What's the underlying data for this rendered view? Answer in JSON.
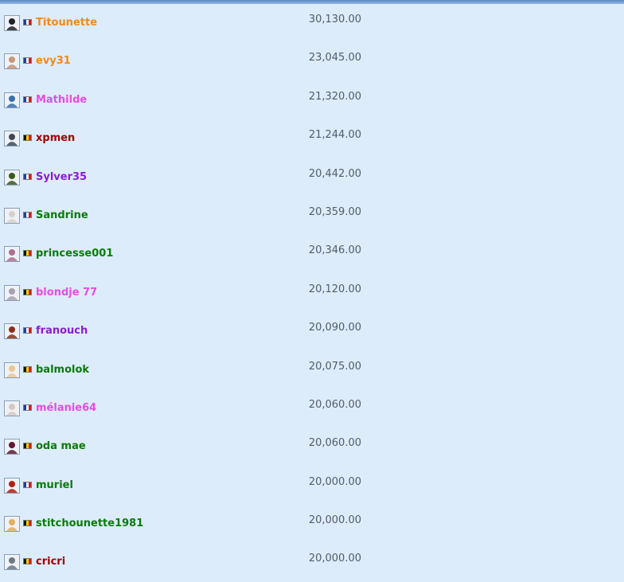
{
  "colors": {
    "orange": "#f08a1a",
    "pink": "#e84ce0",
    "darkred": "#a00000",
    "purple": "#8a1ed0",
    "green": "#0a7a0a",
    "france": [
      "#1a3fa8",
      "#ffffff",
      "#d01a1a"
    ],
    "belgium": [
      "#111111",
      "#f0d000",
      "#d01a1a"
    ]
  },
  "players": [
    {
      "name": "Titounette",
      "country": "france",
      "color": "#f08a1a",
      "score": "30,130.00",
      "avatar_color": "#222222"
    },
    {
      "name": "evy31",
      "country": "france",
      "color": "#f08a1a",
      "score": "23,045.00",
      "avatar_color": "#c89878"
    },
    {
      "name": "Mathilde",
      "country": "france",
      "color": "#e84ce0",
      "score": "21,320.00",
      "avatar_color": "#3a6fb0"
    },
    {
      "name": "xpmen",
      "country": "belgium",
      "color": "#a00000",
      "score": "21,244.00",
      "avatar_color": "#404858"
    },
    {
      "name": "Sylver35",
      "country": "france",
      "color": "#8a1ed0",
      "score": "20,442.00",
      "avatar_color": "#3a5a1a"
    },
    {
      "name": "Sandrine",
      "country": "france",
      "color": "#0a7a0a",
      "score": "20,359.00",
      "avatar_color": "#d8d0c8"
    },
    {
      "name": "princesse001",
      "country": "belgium",
      "color": "#0a7a0a",
      "score": "20,346.00",
      "avatar_color": "#b07090"
    },
    {
      "name": "blondje 77",
      "country": "belgium",
      "color": "#e84ce0",
      "score": "20,120.00",
      "avatar_color": "#a8a0b0"
    },
    {
      "name": "franouch",
      "country": "france",
      "color": "#8a1ed0",
      "score": "20,090.00",
      "avatar_color": "#8a3018"
    },
    {
      "name": "balmolok",
      "country": "belgium",
      "color": "#0a7a0a",
      "score": "20,075.00",
      "avatar_color": "#e8c890"
    },
    {
      "name": "mélanie64",
      "country": "france",
      "color": "#e84ce0",
      "score": "20,060.00",
      "avatar_color": "#d8c8c0"
    },
    {
      "name": "oda mae",
      "country": "belgium",
      "color": "#0a7a0a",
      "score": "20,060.00",
      "avatar_color": "#601830"
    },
    {
      "name": "muriel",
      "country": "france",
      "color": "#0a7a0a",
      "score": "20,000.00",
      "avatar_color": "#b02010"
    },
    {
      "name": "stitchounette1981",
      "country": "belgium",
      "color": "#0a7a0a",
      "score": "20,000.00",
      "avatar_color": "#e0b060"
    },
    {
      "name": "cricri",
      "country": "belgium",
      "color": "#a00000",
      "score": "20,000.00",
      "avatar_color": "#707880"
    }
  ]
}
